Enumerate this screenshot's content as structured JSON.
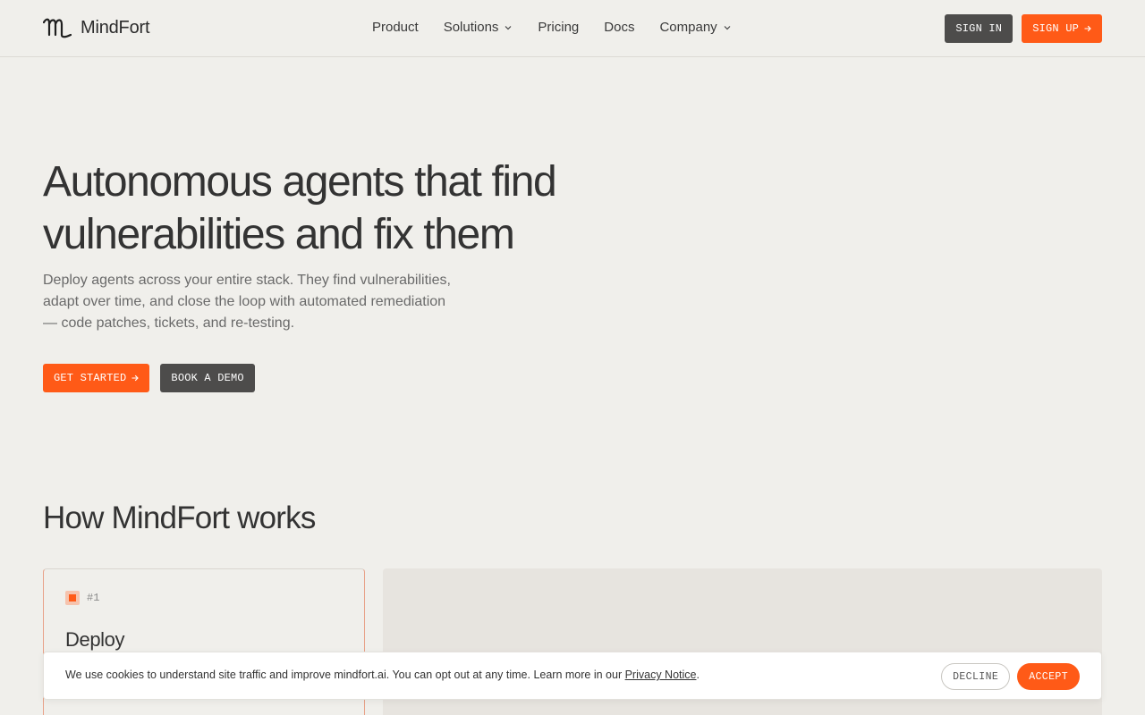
{
  "nav": {
    "brand": "MindFort",
    "links": [
      {
        "label": "Product",
        "has_dropdown": false
      },
      {
        "label": "Solutions",
        "has_dropdown": true
      },
      {
        "label": "Pricing",
        "has_dropdown": false
      },
      {
        "label": "Docs",
        "has_dropdown": false
      },
      {
        "label": "Company",
        "has_dropdown": true
      }
    ],
    "sign_in": "SIGN IN",
    "sign_up": "SIGN UP"
  },
  "hero": {
    "title_line1": "Autonomous agents that find",
    "title_line2": "vulnerabilities and fix them",
    "subtitle": "Deploy agents across your entire stack. They find vulnerabilities, adapt over time, and close the loop with automated remediation — code patches, tickets, and re-testing.",
    "cta_primary": "GET STARTED",
    "cta_secondary": "BOOK A DEMO"
  },
  "how": {
    "title": "How MindFort works",
    "steps": [
      {
        "number": "#1",
        "title": "Deploy"
      }
    ]
  },
  "cookie": {
    "text": "We use cookies to understand site traffic and improve mindfort.ai. You can opt out at any time. Learn more in our ",
    "link": "Privacy Notice",
    "period": ".",
    "decline": "DECLINE",
    "accept": "ACCEPT"
  },
  "icons": {
    "logo": "mindfort-logo-icon",
    "chevron": "chevron-down-icon",
    "arrow": "arrow-right-icon"
  },
  "colors": {
    "accent": "#ff5a17",
    "background": "#f0efeb",
    "dark_button": "#4d4c4b",
    "text": "#333333"
  }
}
